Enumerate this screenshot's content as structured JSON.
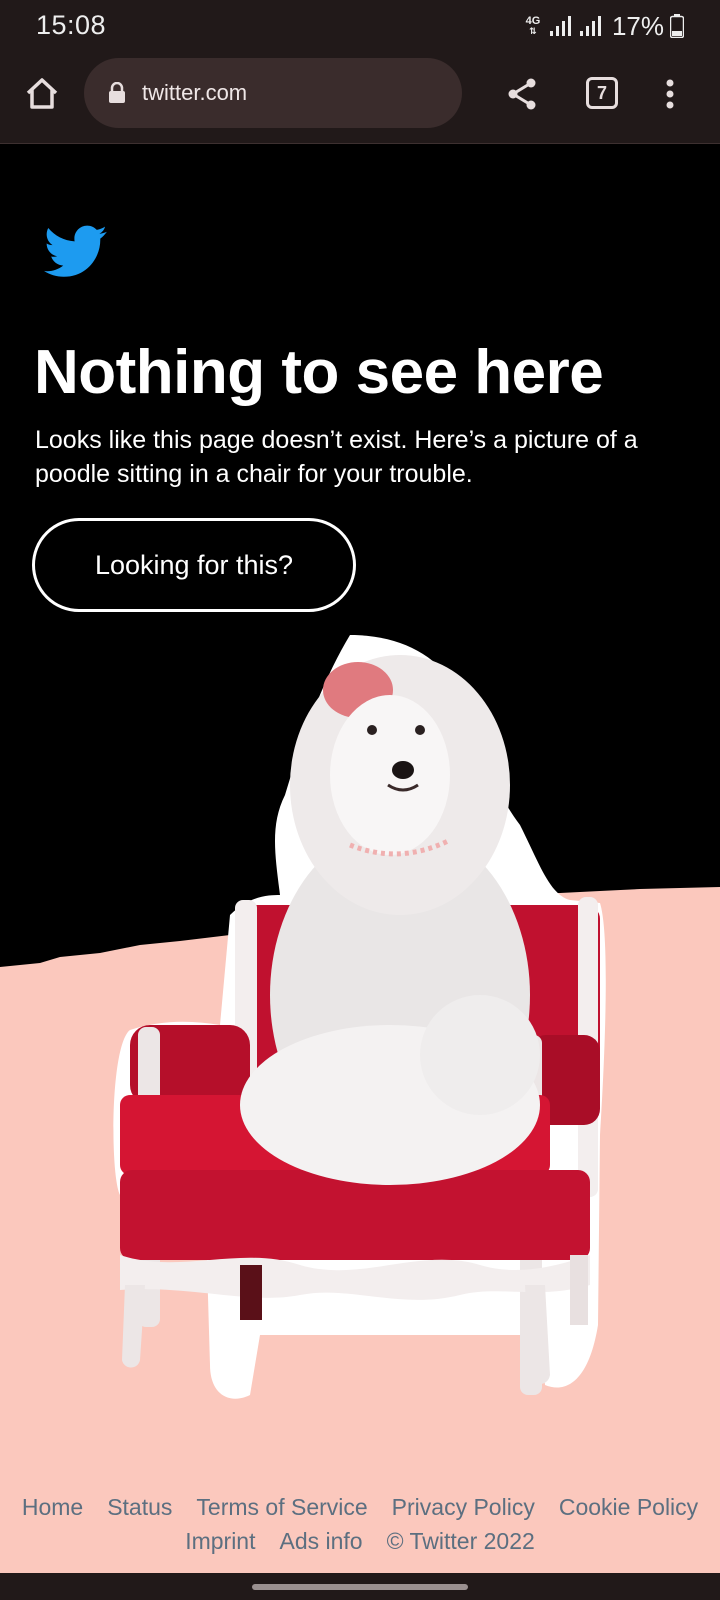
{
  "status_bar": {
    "time": "15:08",
    "network": "4G",
    "battery": "17%"
  },
  "browser": {
    "url": "twitter.com",
    "tab_count": "7"
  },
  "page": {
    "heading": "Nothing to see here",
    "subtext": "Looks like this page doesn’t exist. Here’s a picture of a poodle sitting in a chair for your trouble.",
    "cta_label": "Looking for this?",
    "brand_color": "#1d9bf0",
    "accent_pink": "#fbc8bd"
  },
  "footer": {
    "links_row1": [
      "Home",
      "Status",
      "Terms of Service",
      "Privacy Policy",
      "Cookie Policy"
    ],
    "links_row2": [
      "Imprint",
      "Ads info"
    ],
    "copyright": "© Twitter 2022"
  }
}
